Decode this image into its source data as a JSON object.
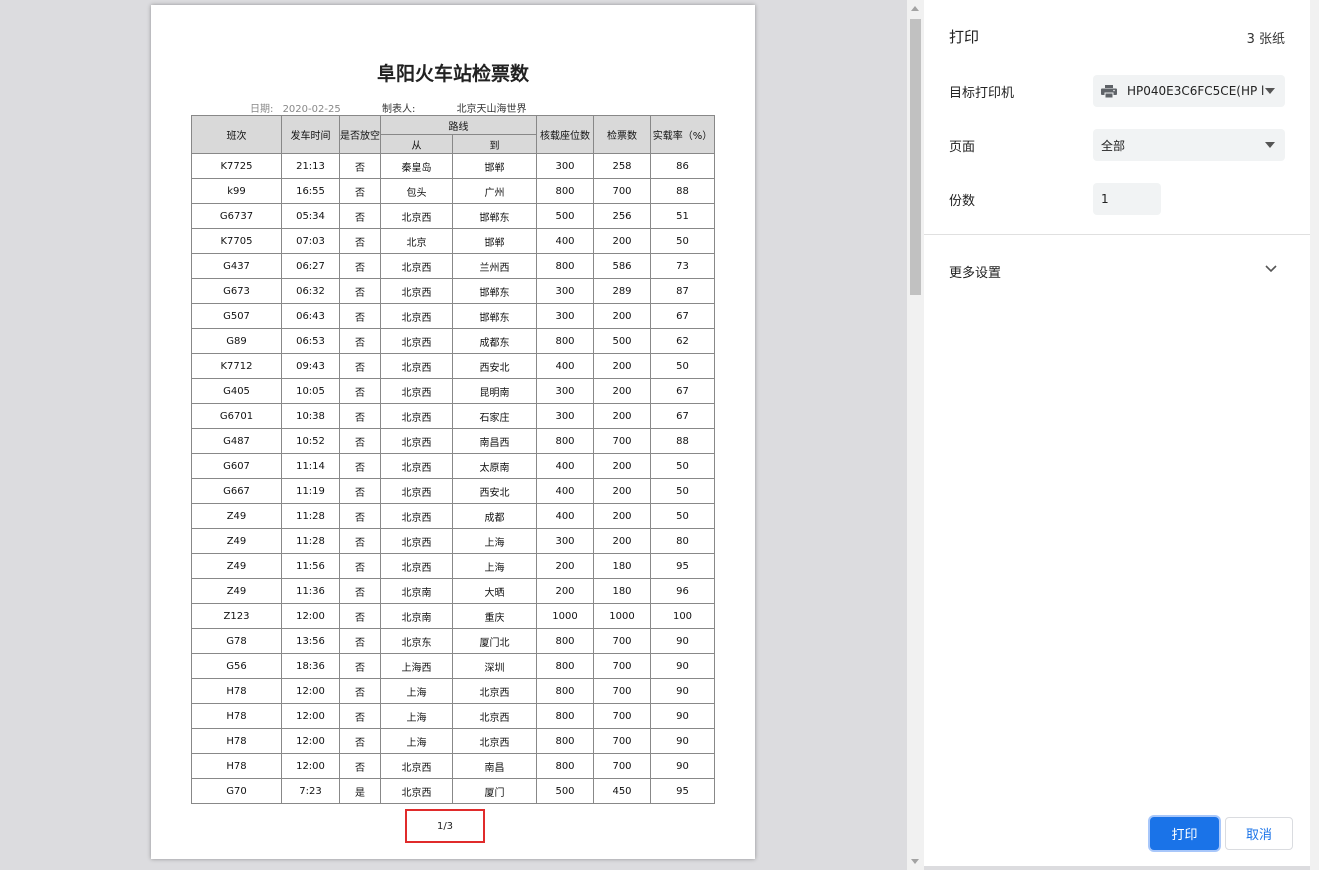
{
  "document": {
    "title": "阜阳火车站检票数",
    "date_label": "日期:",
    "date_value": "2020-02-25",
    "maker_label": "制表人:",
    "maker_value": "北京天山海世界",
    "headers": {
      "train": "班次",
      "depart_time": "发车时间",
      "empty": "是否放空",
      "route": "路线",
      "from": "从",
      "to": "到",
      "seats": "核载座位数",
      "tickets": "检票数",
      "rate": "实载率（%）"
    },
    "rows": [
      [
        "K7725",
        "21:13",
        "否",
        "秦皇岛",
        "邯郸",
        "300",
        "258",
        "86"
      ],
      [
        "k99",
        "16:55",
        "否",
        "包头",
        "广州",
        "800",
        "700",
        "88"
      ],
      [
        "G6737",
        "05:34",
        "否",
        "北京西",
        "邯郸东",
        "500",
        "256",
        "51"
      ],
      [
        "K7705",
        "07:03",
        "否",
        "北京",
        "邯郸",
        "400",
        "200",
        "50"
      ],
      [
        "G437",
        "06:27",
        "否",
        "北京西",
        "兰州西",
        "800",
        "586",
        "73"
      ],
      [
        "G673",
        "06:32",
        "否",
        "北京西",
        "邯郸东",
        "300",
        "289",
        "87"
      ],
      [
        "G507",
        "06:43",
        "否",
        "北京西",
        "邯郸东",
        "300",
        "200",
        "67"
      ],
      [
        "G89",
        "06:53",
        "否",
        "北京西",
        "成都东",
        "800",
        "500",
        "62"
      ],
      [
        "K7712",
        "09:43",
        "否",
        "北京西",
        "西安北",
        "400",
        "200",
        "50"
      ],
      [
        "G405",
        "10:05",
        "否",
        "北京西",
        "昆明南",
        "300",
        "200",
        "67"
      ],
      [
        "G6701",
        "10:38",
        "否",
        "北京西",
        "石家庄",
        "300",
        "200",
        "67"
      ],
      [
        "G487",
        "10:52",
        "否",
        "北京西",
        "南昌西",
        "800",
        "700",
        "88"
      ],
      [
        "G607",
        "11:14",
        "否",
        "北京西",
        "太原南",
        "400",
        "200",
        "50"
      ],
      [
        "G667",
        "11:19",
        "否",
        "北京西",
        "西安北",
        "400",
        "200",
        "50"
      ],
      [
        "Z49",
        "11:28",
        "否",
        "北京西",
        "成都",
        "400",
        "200",
        "50"
      ],
      [
        "Z49",
        "11:28",
        "否",
        "北京西",
        "上海",
        "300",
        "200",
        "80"
      ],
      [
        "Z49",
        "11:56",
        "否",
        "北京西",
        "上海",
        "200",
        "180",
        "95"
      ],
      [
        "Z49",
        "11:36",
        "否",
        "北京南",
        "大晒",
        "200",
        "180",
        "96"
      ],
      [
        "Z123",
        "12:00",
        "否",
        "北京南",
        "重庆",
        "1000",
        "1000",
        "100"
      ],
      [
        "G78",
        "13:56",
        "否",
        "北京东",
        "厦门北",
        "800",
        "700",
        "90"
      ],
      [
        "G56",
        "18:36",
        "否",
        "上海西",
        "深圳",
        "800",
        "700",
        "90"
      ],
      [
        "H78",
        "12:00",
        "否",
        "上海",
        "北京西",
        "800",
        "700",
        "90"
      ],
      [
        "H78",
        "12:00",
        "否",
        "上海",
        "北京西",
        "800",
        "700",
        "90"
      ],
      [
        "H78",
        "12:00",
        "否",
        "上海",
        "北京西",
        "800",
        "700",
        "90"
      ],
      [
        "H78",
        "12:00",
        "否",
        "北京西",
        "南昌",
        "800",
        "700",
        "90"
      ],
      [
        "G70",
        "7:23",
        "是",
        "北京西",
        "厦门",
        "500",
        "450",
        "95"
      ]
    ],
    "page_indicator": "1/3"
  },
  "print_panel": {
    "title": "打印",
    "sheet_count": "3 张纸",
    "destination_label": "目标打印机",
    "destination_value": "HP040E3C6FC5CE(HP l",
    "pages_label": "页面",
    "pages_value": "全部",
    "copies_label": "份数",
    "copies_value": "1",
    "more_settings": "更多设置",
    "print_button": "打印",
    "cancel_button": "取消"
  },
  "colors": {
    "accent": "#1a73e8",
    "highlight_box": "#e02b2b",
    "header_fill": "#d9d9d9"
  },
  "icons": {
    "printer": "printer-icon",
    "dropdown": "caret-down-icon",
    "expand": "chevron-down-icon"
  }
}
